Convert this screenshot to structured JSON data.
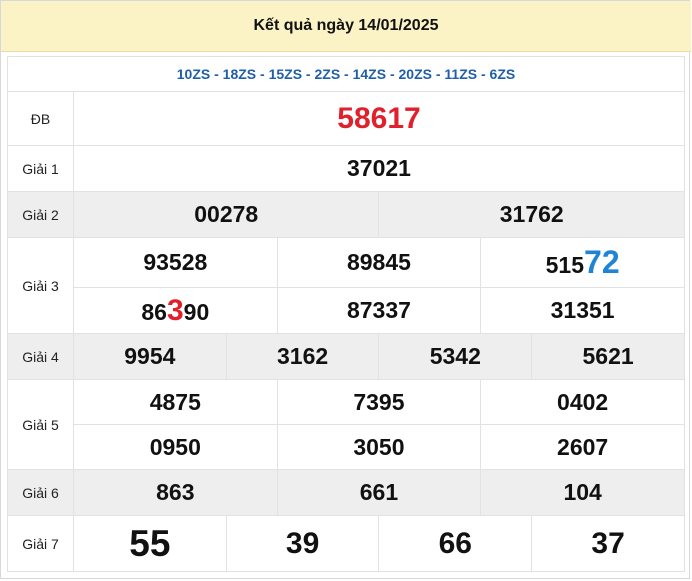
{
  "title": "Kết quả ngày 14/01/2025",
  "codes": "10ZS - 18ZS - 15ZS - 2ZS - 14ZS - 20ZS - 11ZS - 6ZS",
  "labels": {
    "db": "ĐB",
    "g1": "Giải 1",
    "g2": "Giải 2",
    "g3": "Giải 3",
    "g4": "Giải 4",
    "g5": "Giải 5",
    "g6": "Giải 6",
    "g7": "Giải 7"
  },
  "prizes": {
    "db": [
      "58617"
    ],
    "g1": [
      "37021"
    ],
    "g2": [
      "00278",
      "31762"
    ],
    "g3": [
      {
        "prefix": "93528",
        "highlight": "",
        "suffix": ""
      },
      {
        "prefix": "89845",
        "highlight": "",
        "suffix": ""
      },
      {
        "prefix": "515",
        "highlight": "72",
        "suffix": ""
      },
      {
        "prefix": "86",
        "highlight": "3",
        "suffix": "90"
      },
      {
        "prefix": "87337",
        "highlight": "",
        "suffix": ""
      },
      {
        "prefix": "31351",
        "highlight": "",
        "suffix": ""
      }
    ],
    "g4": [
      "9954",
      "3162",
      "5342",
      "5621"
    ],
    "g5": [
      "4875",
      "7395",
      "0402",
      "0950",
      "3050",
      "2607"
    ],
    "g6": [
      "863",
      "661",
      "104"
    ],
    "g7": [
      "55",
      "39",
      "66",
      "37"
    ]
  },
  "colors": {
    "header_bg": "#fbf2c6",
    "codes_text": "#1f5fa8",
    "special_red": "#e0202a",
    "highlight_blue": "#1f84d6",
    "shaded_row": "#eeeeee"
  }
}
